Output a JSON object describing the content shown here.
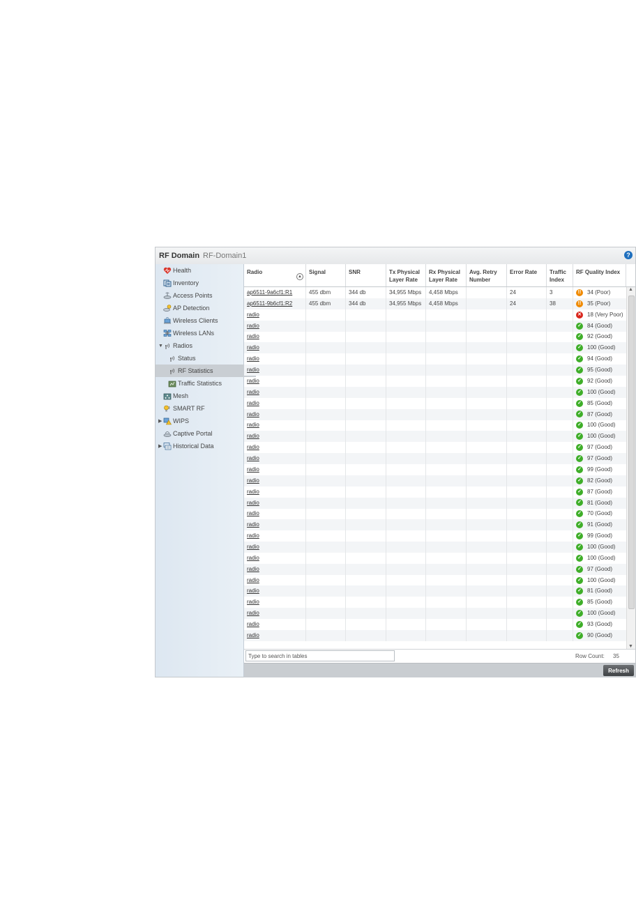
{
  "header": {
    "title": "RF Domain",
    "subtitle": "RF-Domain1",
    "help_icon": "help-icon"
  },
  "sidebar": {
    "items": [
      {
        "label": "Health",
        "icon": "health-icon"
      },
      {
        "label": "Inventory",
        "icon": "inventory-icon"
      },
      {
        "label": "Access Points",
        "icon": "access-point-icon"
      },
      {
        "label": "AP Detection",
        "icon": "ap-detection-icon"
      },
      {
        "label": "Wireless Clients",
        "icon": "wireless-client-icon"
      },
      {
        "label": "Wireless LANs",
        "icon": "wireless-lan-icon"
      },
      {
        "label": "Radios",
        "icon": "radio-icon",
        "expanded": true
      },
      {
        "label": "Status",
        "icon": "radio-icon"
      },
      {
        "label": "RF Statistics",
        "icon": "radio-icon",
        "selected": true
      },
      {
        "label": "Traffic Statistics",
        "icon": "traffic-icon"
      },
      {
        "label": "Mesh",
        "icon": "mesh-icon"
      },
      {
        "label": "SMART RF",
        "icon": "smart-rf-icon"
      },
      {
        "label": "WIPS",
        "icon": "wips-icon",
        "collapsed": true
      },
      {
        "label": "Captive Portal",
        "icon": "captive-portal-icon"
      },
      {
        "label": "Historical Data",
        "icon": "historical-data-icon",
        "collapsed": true
      }
    ]
  },
  "table": {
    "columns": [
      {
        "line1": "Radio",
        "line2": ""
      },
      {
        "line1": "Signal",
        "line2": ""
      },
      {
        "line1": "SNR",
        "line2": ""
      },
      {
        "line1": "Tx Physical",
        "line2": "Layer Rate"
      },
      {
        "line1": "Rx Physical",
        "line2": "Layer Rate"
      },
      {
        "line1": "Avg. Retry",
        "line2": "Number"
      },
      {
        "line1": "Error Rate",
        "line2": ""
      },
      {
        "line1": "Traffic",
        "line2": "Index"
      },
      {
        "line1": "RF Quality Index",
        "line2": ""
      }
    ],
    "sort_icon": "sort-ascending-icon",
    "rows": [
      {
        "radio": "ap6511-9a6cf1:R1",
        "signal": "455 dbm",
        "snr": "344 db",
        "tx": "34,955 Mbps",
        "rx": "4,458 Mbps",
        "retry": "",
        "error": "24",
        "traffic": "3",
        "rfq": "34 (Poor)",
        "status": "poor"
      },
      {
        "radio": "ap6511-9b6cf1:R2",
        "signal": "455 dbm",
        "snr": "344 db",
        "tx": "34,955 Mbps",
        "rx": "4,458 Mbps",
        "retry": "",
        "error": "24",
        "traffic": "38",
        "rfq": "35 (Poor)",
        "status": "poor"
      },
      {
        "radio": "radio",
        "rfq": "18 (Very Poor)",
        "status": "very-poor"
      },
      {
        "radio": "radio",
        "rfq": "84 (Good)",
        "status": "good"
      },
      {
        "radio": "radio",
        "rfq": "92 (Good)",
        "status": "good"
      },
      {
        "radio": "radio",
        "rfq": "100 (Good)",
        "status": "good"
      },
      {
        "radio": "radio",
        "rfq": "94 (Good)",
        "status": "good"
      },
      {
        "radio": "radio",
        "rfq": "95 (Good)",
        "status": "good"
      },
      {
        "radio": "radio",
        "rfq": "92 (Good)",
        "status": "good"
      },
      {
        "radio": "radio",
        "rfq": "100 (Good)",
        "status": "good"
      },
      {
        "radio": "radio",
        "rfq": "85 (Good)",
        "status": "good"
      },
      {
        "radio": "radio",
        "rfq": "87 (Good)",
        "status": "good"
      },
      {
        "radio": "radio",
        "rfq": "100 (Good)",
        "status": "good"
      },
      {
        "radio": "radio",
        "rfq": "100 (Good)",
        "status": "good"
      },
      {
        "radio": "radio",
        "rfq": "97 (Good)",
        "status": "good"
      },
      {
        "radio": "radio",
        "rfq": "97 (Good)",
        "status": "good"
      },
      {
        "radio": "radio",
        "rfq": "99 (Good)",
        "status": "good"
      },
      {
        "radio": "radio",
        "rfq": "82 (Good)",
        "status": "good"
      },
      {
        "radio": "radio",
        "rfq": "87 (Good)",
        "status": "good"
      },
      {
        "radio": "radio",
        "rfq": "81 (Good)",
        "status": "good"
      },
      {
        "radio": "radio",
        "rfq": "70 (Good)",
        "status": "good"
      },
      {
        "radio": "radio",
        "rfq": "91 (Good)",
        "status": "good"
      },
      {
        "radio": "radio",
        "rfq": "99 (Good)",
        "status": "good"
      },
      {
        "radio": "radio",
        "rfq": "100 (Good)",
        "status": "good"
      },
      {
        "radio": "radio",
        "rfq": "100 (Good)",
        "status": "good"
      },
      {
        "radio": "radio",
        "rfq": "97 (Good)",
        "status": "good"
      },
      {
        "radio": "radio",
        "rfq": "100 (Good)",
        "status": "good"
      },
      {
        "radio": "radio",
        "rfq": "81 (Good)",
        "status": "good"
      },
      {
        "radio": "radio",
        "rfq": "85 (Good)",
        "status": "good"
      },
      {
        "radio": "radio",
        "rfq": "100 (Good)",
        "status": "good"
      },
      {
        "radio": "radio",
        "rfq": "93 (Good)",
        "status": "good"
      },
      {
        "radio": "radio",
        "rfq": "90 (Good)",
        "status": "good"
      }
    ]
  },
  "status_colors": {
    "good": "#3fae29",
    "poor": "#f08a00",
    "very-poor": "#d9261c"
  },
  "footer": {
    "search_placeholder": "Type to search in tables",
    "row_count_label": "Row Count:",
    "row_count": "35"
  },
  "actions": {
    "refresh_label": "Refresh"
  }
}
